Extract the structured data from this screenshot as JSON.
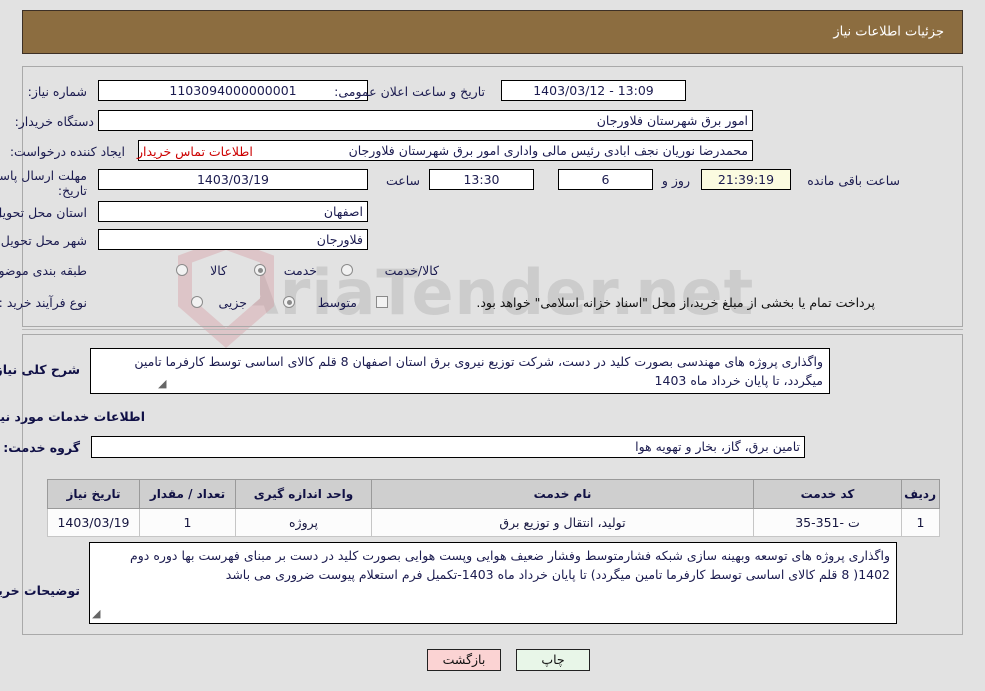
{
  "header": {
    "title": "جزئیات اطلاعات نیاز"
  },
  "watermark": {
    "text": "AriaTender.net"
  },
  "form": {
    "need_number": {
      "label": "شماره نیاز:",
      "value": "1103094000000001"
    },
    "announce_datetime": {
      "label": "تاریخ و ساعت اعلان عمومی:",
      "value": "13:09 - 1403/03/12"
    },
    "buyer_org": {
      "label": "نام دستگاه خریدار:",
      "value": "امور برق شهرستان فلاورجان"
    },
    "blank_field": {
      "value": ""
    },
    "requester": {
      "label": "ایجاد کننده درخواست:",
      "value": "محمدرضا نوریان نجف ابادی رئیس مالی واداری  امور برق شهرستان فلاورجان"
    },
    "contact_link": {
      "label": "اطلاعات تماس خریدار"
    },
    "deadline": {
      "label_line1": "مهلت ارسال پاسخ: تا",
      "label_line2": "تاریخ:",
      "date": "1403/03/19",
      "time_label": "ساعت",
      "time": "13:30",
      "days": "6",
      "days_label": "روز و",
      "countdown": "21:39:19",
      "countdown_label": "ساعت باقی مانده"
    },
    "province": {
      "label": "استان محل تحویل:",
      "value": "اصفهان"
    },
    "city": {
      "label": "شهر محل تحویل:",
      "value": "فلاورجان"
    },
    "classification": {
      "label": "طبقه بندی موضوعی:",
      "options": [
        {
          "label": "کالا",
          "selected": false
        },
        {
          "label": "خدمت",
          "selected": true
        },
        {
          "label": "کالا/خدمت",
          "selected": false
        }
      ]
    },
    "purchase_process": {
      "label": "نوع فرآیند خرید :",
      "options": [
        {
          "label": "جزیی",
          "selected": false
        },
        {
          "label": "متوسط",
          "selected": true
        }
      ],
      "checkbox_label": "پرداخت تمام یا بخشی از مبلغ خرید،از محل \"اسناد خزانه اسلامی\" خواهد بود.",
      "checkbox_checked": false
    }
  },
  "description": {
    "label": "شرح کلی نیاز:",
    "value": "واگذاری پروژه های مهندسی بصورت کلید در دست، شرکت توزیع نیروی برق استان اصفهان 8 قلم کالای اساسی توسط کارفرما تامین میگردد، تا پایان خرداد ماه 1403"
  },
  "services_section": {
    "heading": "اطلاعات خدمات مورد نیاز",
    "service_group": {
      "label": "گروه خدمت:",
      "value": "تامین برق، گاز، بخار و تهویه هوا"
    }
  },
  "table": {
    "columns": [
      "ردیف",
      "کد خدمت",
      "نام خدمت",
      "واحد اندازه گیری",
      "تعداد / مقدار",
      "تاریخ نیاز"
    ],
    "rows": [
      {
        "row_no": "1",
        "service_code": "ت -351-35",
        "service_name": "تولید، انتقال و توزیع برق",
        "unit": "پروژه",
        "quantity": "1",
        "need_date": "1403/03/19"
      }
    ]
  },
  "buyer_notes": {
    "label": "توضیحات خریدار:",
    "value": "واگذاری پروژه های توسعه وبهینه سازی شبکه فشارمتوسط وفشار ضعیف هوایی وپست هوایی بصورت کلید در دست بر مبنای فهرست بها دوره دوم 1402( 8 قلم کالای اساسی توسط کارفرما تامین میگردد) تا پایان خرداد ماه 1403-تکمیل فرم استعلام پیوست ضروری می باشد"
  },
  "footer": {
    "print_label": "چاپ",
    "back_label": "بازگشت"
  },
  "colors": {
    "header_bg": "#8c6d40",
    "link_red": "#cc0000",
    "countdown_bg": "#fbfbe0",
    "print_bg": "#e8f6e8",
    "back_bg": "#fbd3d3"
  }
}
